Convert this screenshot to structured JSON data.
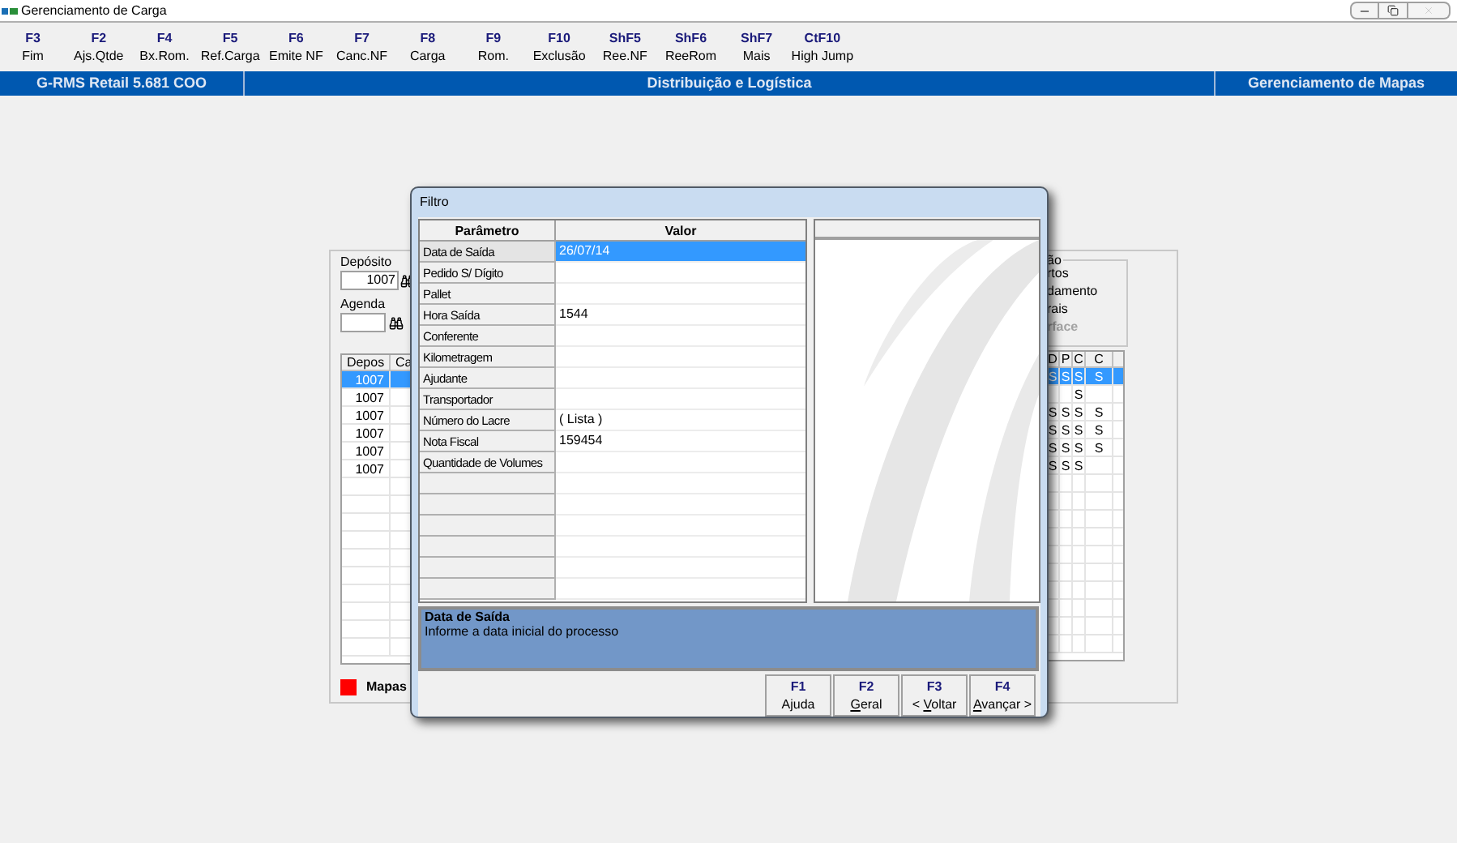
{
  "window": {
    "title": "Gerenciamento de Carga"
  },
  "toolbar": [
    {
      "key": "F3",
      "label": "Fim"
    },
    {
      "key": "F2",
      "label": "Ajs.Qtde"
    },
    {
      "key": "F4",
      "label": "Bx.Rom."
    },
    {
      "key": "F5",
      "label": "Ref.Carga"
    },
    {
      "key": "F6",
      "label": "Emite NF"
    },
    {
      "key": "F7",
      "label": "Canc.NF"
    },
    {
      "key": "F8",
      "label": "Carga"
    },
    {
      "key": "F9",
      "label": "Rom."
    },
    {
      "key": "F10",
      "label": "Exclusão"
    },
    {
      "key": "ShF5",
      "label": "Ree.NF"
    },
    {
      "key": "ShF6",
      "label": "ReeRom"
    },
    {
      "key": "ShF7",
      "label": "Mais"
    },
    {
      "key": "CtF10",
      "label": "High Jump"
    }
  ],
  "header_bar": {
    "left": "G-RMS Retail 5.681 COO",
    "center": "Distribuição e Logística",
    "right": "Gerenciamento de Mapas"
  },
  "background_panel": {
    "deposito": {
      "label": "Depósito",
      "value": "1007"
    },
    "agenda": {
      "label": "Agenda"
    },
    "group_title": "ão",
    "options": [
      {
        "text": "rtos",
        "disabled": false
      },
      {
        "text": "damento",
        "disabled": false
      },
      {
        "text": "rais",
        "disabled": false
      },
      {
        "text": "rface",
        "disabled": true
      }
    ],
    "left_table": {
      "columns": [
        "Depos",
        "Ca"
      ],
      "rows": [
        {
          "depos": "1007",
          "selected": true
        },
        {
          "depos": "1007",
          "selected": false
        },
        {
          "depos": "1007",
          "selected": false
        },
        {
          "depos": "1007",
          "selected": false
        },
        {
          "depos": "1007",
          "selected": false
        },
        {
          "depos": "1007",
          "selected": false
        }
      ]
    },
    "right_table": {
      "columns": [
        "D",
        "P",
        "C",
        "C"
      ],
      "rows": [
        {
          "cells": [
            "S",
            "S",
            "S",
            "S"
          ],
          "selected": true
        },
        {
          "cells": [
            null,
            null,
            "S",
            null
          ],
          "selected": false
        },
        {
          "cells": [
            "S",
            "S",
            "S",
            "S"
          ],
          "selected": false
        },
        {
          "cells": [
            "S",
            "S",
            "S",
            "S"
          ],
          "selected": false
        },
        {
          "cells": [
            "S",
            "S",
            "S",
            "S"
          ],
          "selected": false
        },
        {
          "cells": [
            "S",
            "S",
            "S",
            null
          ],
          "selected": false
        }
      ]
    },
    "legend": {
      "label": "Mapas",
      "color": "#ff0000"
    }
  },
  "dialog": {
    "title": "Filtro",
    "columns": [
      "Parâmetro",
      "Valor"
    ],
    "rows": [
      {
        "parameter": "Data de Saída",
        "value": "26/07/14",
        "selected": true
      },
      {
        "parameter": "Pedido S/ Dígito",
        "selected": false
      },
      {
        "parameter": "Pallet",
        "selected": false
      },
      {
        "parameter": "Hora Saída",
        "value": "1544",
        "selected": false
      },
      {
        "parameter": "Conferente",
        "selected": false
      },
      {
        "parameter": "Kilometragem",
        "selected": false
      },
      {
        "parameter": "Ajudante",
        "selected": false
      },
      {
        "parameter": "Transportador",
        "selected": false
      },
      {
        "parameter": "Número do Lacre",
        "value": "( Lista )",
        "selected": false
      },
      {
        "parameter": "Nota Fiscal",
        "value": "159454",
        "selected": false
      },
      {
        "parameter": "Quantidade de Volumes",
        "selected": false
      }
    ],
    "description": {
      "title": "Data de Saída",
      "text": "Informe a data inicial do processo"
    },
    "buttons": [
      {
        "key": "F1",
        "label": "Ajuda"
      },
      {
        "key": "F2",
        "mnemonic": "G",
        "label_after": "eral"
      },
      {
        "key": "F3",
        "label_before": "< ",
        "mnemonic": "V",
        "label_after": "oltar"
      },
      {
        "key": "F4",
        "mnemonic": "A",
        "label_after": "vançar >"
      }
    ]
  }
}
